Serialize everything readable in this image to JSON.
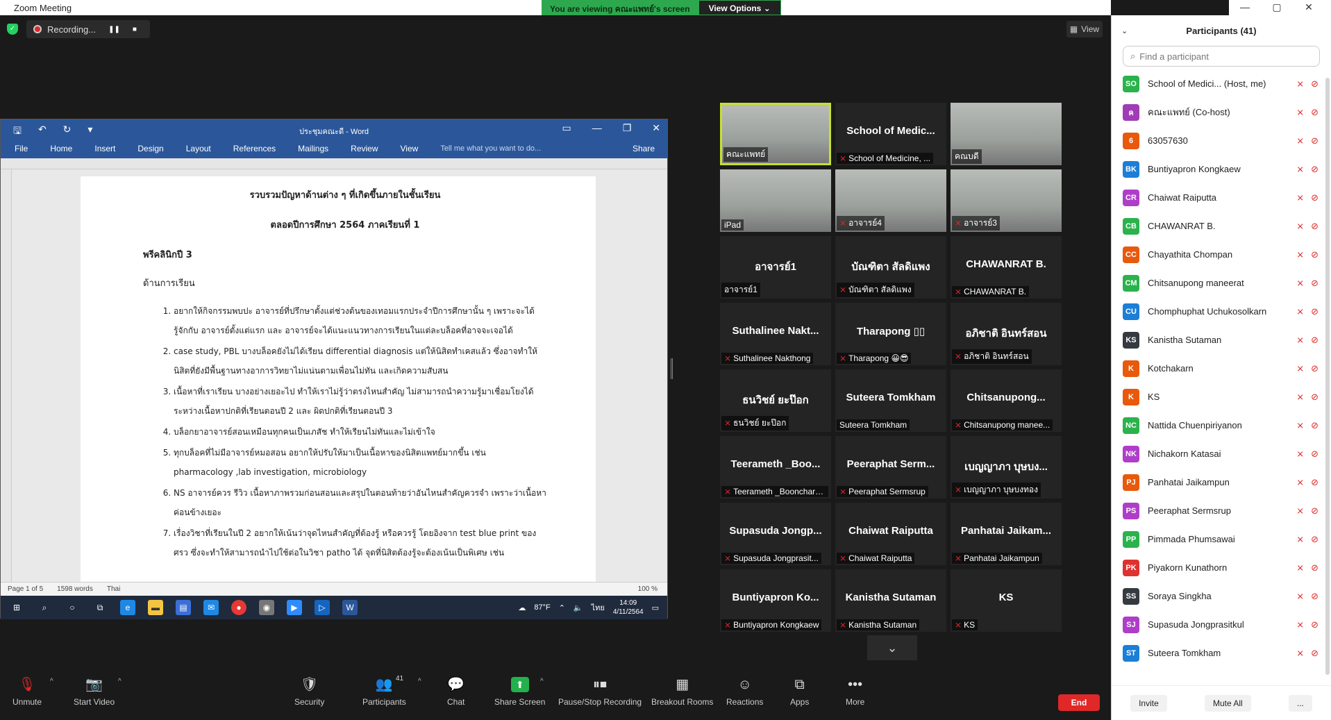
{
  "window": {
    "title": "Zoom Meeting",
    "min": "—",
    "max": "▢",
    "close": "✕"
  },
  "banner": {
    "message": "You are viewing คณะแพทย์'s screen",
    "options": "View Options ⌄"
  },
  "recording": {
    "label": "Recording..."
  },
  "view_button": "View",
  "word": {
    "title": "ประชุมคณะดี - Word",
    "tabs": [
      "File",
      "Home",
      "Insert",
      "Design",
      "Layout",
      "References",
      "Mailings",
      "Review",
      "View"
    ],
    "tell_me": "Tell me what you want to do...",
    "share": "Share",
    "doc": {
      "heading1": "รวบรวมปัญหาด้านต่าง ๆ ที่เกิดขึ้นภายในชั้นเรียน",
      "heading2": "ตลอดปีการศึกษา 2564 ภาคเรียนที่ 1",
      "section": "พรีคลินิกปี 3",
      "subsection": "ด้านการเรียน",
      "items": [
        "อยากให้กิจกรรมพบปะ อาจารย์ที่ปรึกษาตั้งแต่ช่วงต้นของเทอมแรกประจำปีการศึกษานั้น ๆ เพราะจะได้รู้จักกับ อาจารย์ตั้งแต่แรก และ อาจารย์จะได้แนะแนวทางการเรียนในแต่ละบล็อคที่อาจจะเจอได้",
        "case study, PBL บางบล็อคยังไม่ได้เรียน differential diagnosis แต่ให้นิสิตทำเคสแล้ว ซึ่งอาจทำให้นิสิตที่ยังมีพื้นฐานทางอาการวิทยาไม่แน่นตามเพื่อนไม่ทัน และเกิดความสับสน",
        "เนื้อหาที่เราเรียน บางอย่างเยอะไป ทำให้เราไม่รู้ว่าตรงไหนสำคัญ ไม่สามารถนำความรู้มาเชื่อมโยงได้ระหว่างเนื้อหาปกติที่เรียนตอนปี 2 และ ผิดปกติที่เรียนตอนปี 3",
        "บล็อกยาอาจารย์สอนเหมือนทุกคนเป็นเภสัช ทำให้เรียนไม่ทันและไม่เข้าใจ",
        "ทุกบล็อคที่ไม่มีอาจารย์หมอสอน อยากให้ปรับให้มาเป็นเนื้อหาของนิสิตแพทย์มากขึ้น เช่น pharmacology ,lab investigation, microbiology",
        "NS อาจารย์ควร รีวิว เนื้อหาภาพรวมก่อนสอนและสรุปในตอนท้ายว่าอันไหนสำคัญควรจำ เพราะว่าเนื้อหาค่อนข้างเยอะ",
        "เรื่องวิชาที่เรียนในปี 2 อยากให้เน้นว่าจุดไหนสำคัญที่ต้องรู้ หรือควรรู้ โดยอิงจาก test blue print ของศรว ซึ่งจะทำให้สามารถนำไปใช้ต่อในวิชา patho ได้ จุดที่นิสิตต้องรู้จะต้องเน้นเป็นพิเศษ เช่น"
      ]
    },
    "status": {
      "page": "Page 1 of 5",
      "words": "1598 words",
      "lang": "Thai",
      "zoom": "100 %"
    }
  },
  "taskbar": {
    "weather": "87°F",
    "time": "14:09",
    "date": "4/11/2564",
    "lang": "ไทย"
  },
  "tiles": [
    {
      "name": "",
      "caption": "คณะแพทย์",
      "video": true,
      "active": true,
      "muted": false
    },
    {
      "name": "School of Medic...",
      "caption": "School of Medicine, ...",
      "video": false,
      "muted": true
    },
    {
      "name": "",
      "caption": "คณบดี",
      "video": true,
      "muted": false
    },
    {
      "name": "",
      "caption": "iPad",
      "video": true,
      "muted": false
    },
    {
      "name": "",
      "caption": "อาจารย์4",
      "video": true,
      "muted": true
    },
    {
      "name": "",
      "caption": "อาจารย์3",
      "video": true,
      "muted": true
    },
    {
      "name": "อาจารย์1",
      "caption": "อาจารย์1",
      "video": false,
      "muted": false
    },
    {
      "name": "บัณฑิตา สัลดิแพง",
      "caption": "บัณฑิตา สัลดิแพง",
      "video": false,
      "muted": true
    },
    {
      "name": "CHAWANRAT B.",
      "caption": "CHAWANRAT B.",
      "video": false,
      "muted": true
    },
    {
      "name": "Suthalinee Nakt...",
      "caption": "Suthalinee Nakthong",
      "video": false,
      "muted": true
    },
    {
      "name": "Tharapong ▯▯",
      "caption": "Tharapong 😀😎",
      "video": false,
      "muted": true
    },
    {
      "name": "อภิชาติ อินทร์สอน",
      "caption": "อภิชาติ อินทร์สอน",
      "video": false,
      "muted": true
    },
    {
      "name": "ธนวิชย์ ยะป๊อก",
      "caption": "ธนวิชย์ ยะป๊อก",
      "video": false,
      "muted": true
    },
    {
      "name": "Suteera Tomkham",
      "caption": "Suteera Tomkham",
      "video": false,
      "muted": false
    },
    {
      "name": "Chitsanupong...",
      "caption": "Chitsanupong manee...",
      "video": false,
      "muted": true
    },
    {
      "name": "Teerameth _Boo...",
      "caption": "Teerameth _Booncharo...",
      "video": false,
      "muted": true
    },
    {
      "name": "Peeraphat Serm...",
      "caption": "Peeraphat Sermsrup",
      "video": false,
      "muted": true
    },
    {
      "name": "เบญญาภา บุษบง...",
      "caption": "เบญญาภา บุษบงทอง",
      "video": false,
      "muted": true
    },
    {
      "name": "Supasuda Jongp...",
      "caption": "Supasuda Jongprasit...",
      "video": false,
      "muted": true
    },
    {
      "name": "Chaiwat Raiputta",
      "caption": "Chaiwat Raiputta",
      "video": false,
      "muted": true
    },
    {
      "name": "Panhatai Jaikam...",
      "caption": "Panhatai Jaikampun",
      "video": false,
      "muted": true
    },
    {
      "name": "Buntiyapron Ko...",
      "caption": "Buntiyapron Kongkaew",
      "video": false,
      "muted": true
    },
    {
      "name": "Kanistha Sutaman",
      "caption": "Kanistha Sutaman",
      "video": false,
      "muted": true
    },
    {
      "name": "KS",
      "caption": "KS",
      "video": false,
      "muted": true
    }
  ],
  "participants_panel": {
    "title": "Participants (41)",
    "search_placeholder": "Find a participant",
    "rows": [
      {
        "initials": "SO",
        "color": "#2bb24c",
        "name": "School of Medici... (Host, me)"
      },
      {
        "initials": "ค",
        "color": "#a03cb5",
        "name": "คณะแพทย์ (Co-host)"
      },
      {
        "initials": "6",
        "color": "#e8590c",
        "name": "63057630"
      },
      {
        "initials": "BK",
        "color": "#1c7ed6",
        "name": "Buntiyapron Kongkaew"
      },
      {
        "initials": "CR",
        "color": "#ae3ec9",
        "name": "Chaiwat Raiputta"
      },
      {
        "initials": "CB",
        "color": "#2bb24c",
        "name": "CHAWANRAT B."
      },
      {
        "initials": "CC",
        "color": "#e8590c",
        "name": "Chayathita Chompan"
      },
      {
        "initials": "CM",
        "color": "#2bb24c",
        "name": "Chitsanupong maneerat"
      },
      {
        "initials": "CU",
        "color": "#1c7ed6",
        "name": "Chomphuphat Uchukosolkarn"
      },
      {
        "initials": "KS",
        "color": "#343a40",
        "name": "Kanistha Sutaman"
      },
      {
        "initials": "K",
        "color": "#e8590c",
        "name": "Kotchakarn"
      },
      {
        "initials": "K",
        "color": "#e8590c",
        "name": "KS"
      },
      {
        "initials": "NC",
        "color": "#2bb24c",
        "name": "Nattida Chuenpiriyanon"
      },
      {
        "initials": "NK",
        "color": "#ae3ec9",
        "name": "Nichakorn Katasai"
      },
      {
        "initials": "PJ",
        "color": "#e8590c",
        "name": "Panhatai Jaikampun"
      },
      {
        "initials": "PS",
        "color": "#ae3ec9",
        "name": "Peeraphat Sermsrup"
      },
      {
        "initials": "PP",
        "color": "#2bb24c",
        "name": "Pimmada Phumsawai"
      },
      {
        "initials": "PK",
        "color": "#e03131",
        "name": "Piyakorn Kunathorn"
      },
      {
        "initials": "SS",
        "color": "#343a40",
        "name": "Soraya Singkha"
      },
      {
        "initials": "SJ",
        "color": "#ae3ec9",
        "name": "Supasuda Jongprasitkul"
      },
      {
        "initials": "ST",
        "color": "#1c7ed6",
        "name": "Suteera Tomkham"
      }
    ],
    "footer": [
      "Invite",
      "Mute All",
      "..."
    ]
  },
  "toolbar": {
    "unmute": "Unmute",
    "start_video": "Start Video",
    "security": "Security",
    "participants": "Participants",
    "participants_count": "41",
    "chat": "Chat",
    "share_screen": "Share Screen",
    "pause_stop": "Pause/Stop Recording",
    "breakout": "Breakout Rooms",
    "reactions": "Reactions",
    "apps": "Apps",
    "more": "More",
    "end": "End"
  }
}
